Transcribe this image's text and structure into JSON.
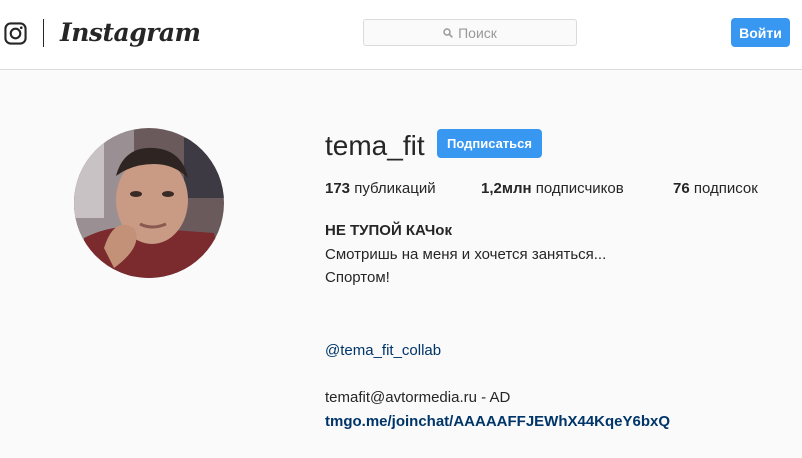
{
  "header": {
    "brand": "Instagram",
    "search_placeholder": "Поиск",
    "login_label": "Войти"
  },
  "profile": {
    "username": "tema_fit",
    "follow_label": "Подписаться",
    "stats": {
      "posts_count": "173",
      "posts_label": "публикаций",
      "followers_count": "1,2млн",
      "followers_label": "подписчиков",
      "following_count": "76",
      "following_label": "подписок"
    },
    "bio": {
      "name": "НЕ ТУПОЙ КАЧок",
      "line1": "Смотришь на меня и хочется заняться...",
      "line2": "Спортом!",
      "mention": "@tema_fit_collab",
      "email": "temafit@avtormedia.ru - AD",
      "link": "tmgo.me/joinchat/AAAAAFFJEWhX44KqeY6bxQ"
    }
  }
}
